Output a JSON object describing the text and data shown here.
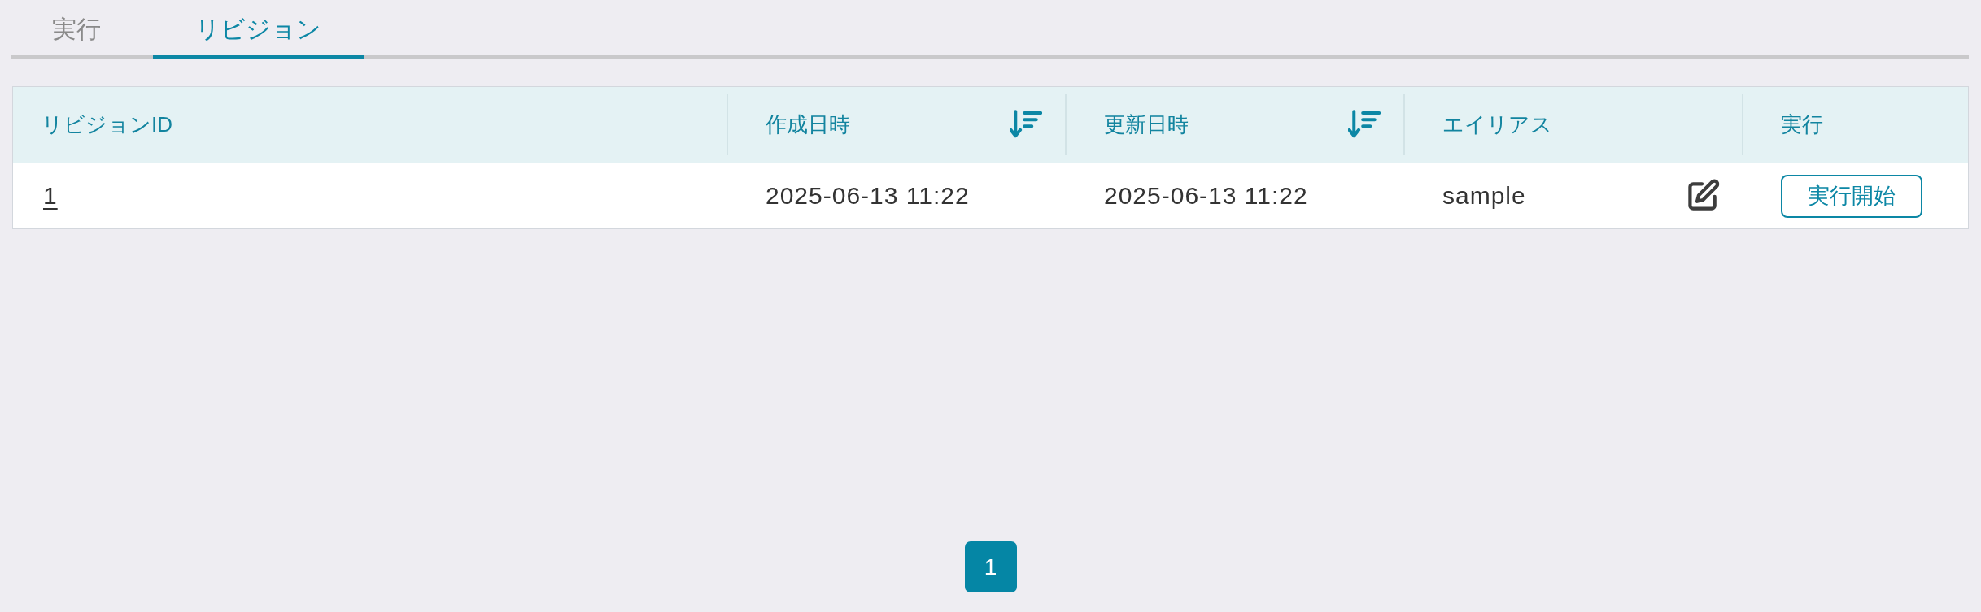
{
  "tabs": [
    {
      "label": "実行",
      "selected": false
    },
    {
      "label": "リビジョン",
      "selected": true
    }
  ],
  "table": {
    "columns": [
      {
        "label": "リビジョンID",
        "sortable": false
      },
      {
        "label": "作成日時",
        "sortable": true
      },
      {
        "label": "更新日時",
        "sortable": true
      },
      {
        "label": "エイリアス",
        "sortable": false
      },
      {
        "label": "実行",
        "sortable": false
      }
    ],
    "rows": [
      {
        "cells": [
          {
            "kind": "link",
            "text": "1"
          },
          {
            "kind": "text",
            "text": "2025-06-13 11:22"
          },
          {
            "kind": "text",
            "text": "2025-06-13 11:22"
          },
          {
            "kind": "editable",
            "text": "sample"
          },
          {
            "kind": "button",
            "text": "実行開始"
          }
        ]
      }
    ]
  },
  "pagination": {
    "pages": [
      {
        "label": "1",
        "selected": true
      }
    ]
  }
}
